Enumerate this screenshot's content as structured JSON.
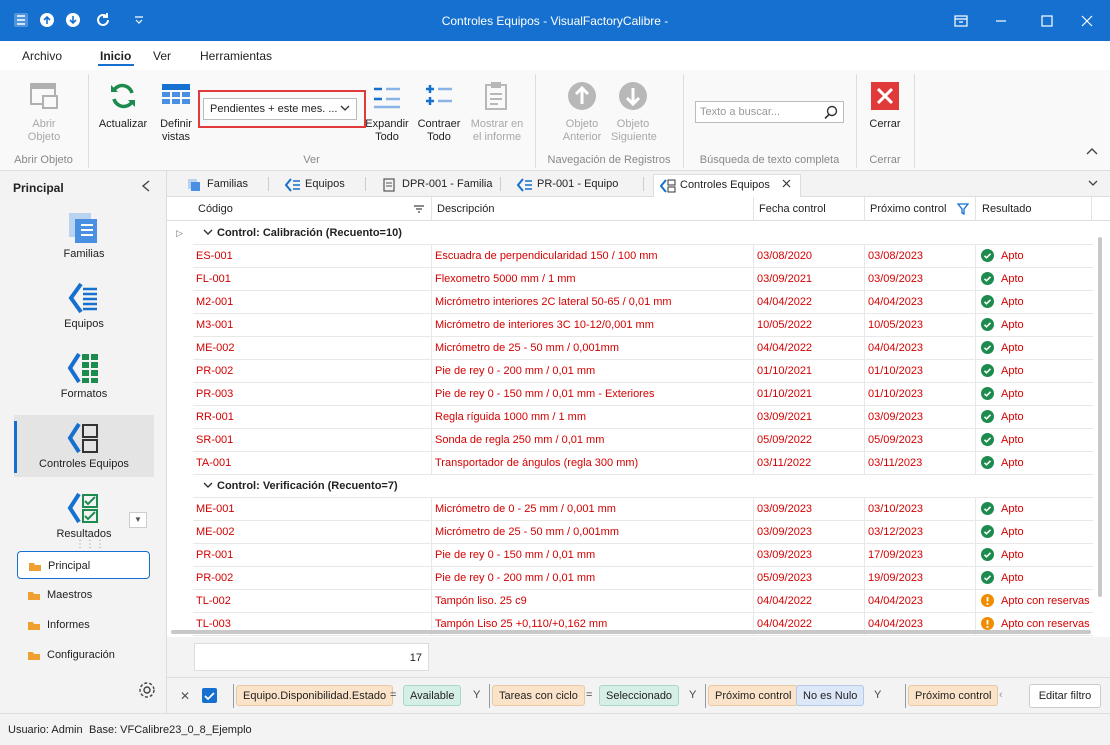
{
  "window": {
    "title": "Controles Equipos - VisualFactoryCalibre -"
  },
  "menu": {
    "tabs": [
      "Archivo",
      "Inicio",
      "Ver",
      "Herramientas"
    ]
  },
  "ribbon": {
    "abrir_objeto": "Abrir Objeto",
    "group_abrir": "Abrir Objeto",
    "actualizar": "Actualizar",
    "definir_vistas": "Definir vistas",
    "view_select_value": "Pendientes + este mes. ...",
    "expandir_todo": "Expandir Todo",
    "contraer_todo": "Contraer Todo",
    "mostrar_informe": "Mostrar en el informe",
    "group_ver": "Ver",
    "objeto_anterior": "Objeto Anterior",
    "objeto_siguiente": "Objeto Siguiente",
    "group_nav": "Navegación de Registros",
    "search_placeholder": "Texto a buscar...",
    "group_search": "Búsqueda de texto completa",
    "cerrar": "Cerrar",
    "group_cerrar": "Cerrar"
  },
  "sidebar": {
    "title": "Principal",
    "items": [
      "Familias",
      "Equipos",
      "Formatos",
      "Controles Equipos",
      "Resultados"
    ],
    "groups": [
      "Principal",
      "Maestros",
      "Informes",
      "Configuración"
    ]
  },
  "doc_tabs": [
    "Familias",
    "Equipos",
    "DPR-001 - Familia",
    "PR-001 - Equipo",
    "Controles Equipos"
  ],
  "grid": {
    "columns": [
      "Código",
      "Descripción",
      "Fecha control",
      "Próximo control",
      "Resultado"
    ],
    "groups": [
      {
        "label": "Control: Calibración (Recuento=10)",
        "rows": [
          {
            "codigo": "ES-001",
            "descripcion": "Escuadra de perpendicularidad 150 / 100 mm",
            "fecha": "03/08/2020",
            "proximo": "03/08/2023",
            "resultado": "Apto",
            "status": "ok"
          },
          {
            "codigo": "FL-001",
            "descripcion": "Flexometro 5000 mm / 1 mm",
            "fecha": "03/09/2021",
            "proximo": "03/09/2023",
            "resultado": "Apto",
            "status": "ok"
          },
          {
            "codigo": "M2-001",
            "descripcion": "Micrómetro interiores 2C lateral 50-65 / 0,01 mm",
            "fecha": "04/04/2022",
            "proximo": "04/04/2023",
            "resultado": "Apto",
            "status": "ok"
          },
          {
            "codigo": "M3-001",
            "descripcion": "Micrómetro de interiores 3C 10-12/0,001 mm",
            "fecha": "10/05/2022",
            "proximo": "10/05/2023",
            "resultado": "Apto",
            "status": "ok"
          },
          {
            "codigo": "ME-002",
            "descripcion": "Micrómetro de 25 - 50 mm / 0,001mm",
            "fecha": "04/04/2022",
            "proximo": "04/04/2023",
            "resultado": "Apto",
            "status": "ok"
          },
          {
            "codigo": "PR-002",
            "descripcion": "Pie de rey 0 - 200 mm / 0,01 mm",
            "fecha": "01/10/2021",
            "proximo": "01/10/2023",
            "resultado": "Apto",
            "status": "ok"
          },
          {
            "codigo": "PR-003",
            "descripcion": "Pie de rey 0 - 150 mm / 0,01 mm - Exteriores",
            "fecha": "01/10/2021",
            "proximo": "01/10/2023",
            "resultado": "Apto",
            "status": "ok"
          },
          {
            "codigo": "RR-001",
            "descripcion": "Regla ríguida 1000 mm / 1 mm",
            "fecha": "03/09/2021",
            "proximo": "03/09/2023",
            "resultado": "Apto",
            "status": "ok"
          },
          {
            "codigo": "SR-001",
            "descripcion": "Sonda de regla 250 mm / 0,01 mm",
            "fecha": "05/09/2022",
            "proximo": "05/09/2023",
            "resultado": "Apto",
            "status": "ok"
          },
          {
            "codigo": "TA-001",
            "descripcion": "Transportador de ángulos (regla 300 mm)",
            "fecha": "03/11/2022",
            "proximo": "03/11/2023",
            "resultado": "Apto",
            "status": "ok"
          }
        ]
      },
      {
        "label": "Control: Verificación (Recuento=7)",
        "rows": [
          {
            "codigo": "ME-001",
            "descripcion": "Micrómetro de 0 - 25 mm / 0,001 mm",
            "fecha": "03/09/2023",
            "proximo": "03/10/2023",
            "resultado": "Apto",
            "status": "ok"
          },
          {
            "codigo": "ME-002",
            "descripcion": "Micrómetro de 25 - 50 mm / 0,001mm",
            "fecha": "03/09/2023",
            "proximo": "03/12/2023",
            "resultado": "Apto",
            "status": "ok"
          },
          {
            "codigo": "PR-001",
            "descripcion": "Pie de rey 0 - 150 mm / 0,01 mm",
            "fecha": "03/09/2023",
            "proximo": "17/09/2023",
            "resultado": "Apto",
            "status": "ok"
          },
          {
            "codigo": "PR-002",
            "descripcion": "Pie de rey 0 - 200 mm / 0,01 mm",
            "fecha": "05/09/2023",
            "proximo": "19/09/2023",
            "resultado": "Apto",
            "status": "ok"
          },
          {
            "codigo": "TL-002",
            "descripcion": "Tampón liso. 25 c9",
            "fecha": "04/04/2022",
            "proximo": "04/04/2023",
            "resultado": "Apto con reservas",
            "status": "warn"
          },
          {
            "codigo": "TL-003",
            "descripcion": "Tampón Liso 25 +0,110/+0,162 mm",
            "fecha": "04/04/2022",
            "proximo": "04/04/2023",
            "resultado": "Apto con reservas",
            "status": "warn"
          }
        ]
      }
    ],
    "total_count": "17"
  },
  "filter": {
    "field1": "Equipo.Disponibilidad.Estado",
    "op1": "=",
    "value1": "Available",
    "and1": "Y",
    "field2": "Tareas con ciclo",
    "op2": "=",
    "value2": "Seleccionado",
    "and2": "Y",
    "field3": "Próximo control",
    "op3": "No es Nulo",
    "and3": "Y",
    "field4": "Próximo control",
    "edit_label": "Editar filtro"
  },
  "statusbar": {
    "user": "Usuario: Admin",
    "base": "Base: VFCalibre23_0_8_Ejemplo"
  },
  "colors": {
    "accent": "#1570d0",
    "ok": "#1d8a4e",
    "warn": "#f08c00",
    "danger": "#e03a3a",
    "row_text": "#d40000"
  }
}
